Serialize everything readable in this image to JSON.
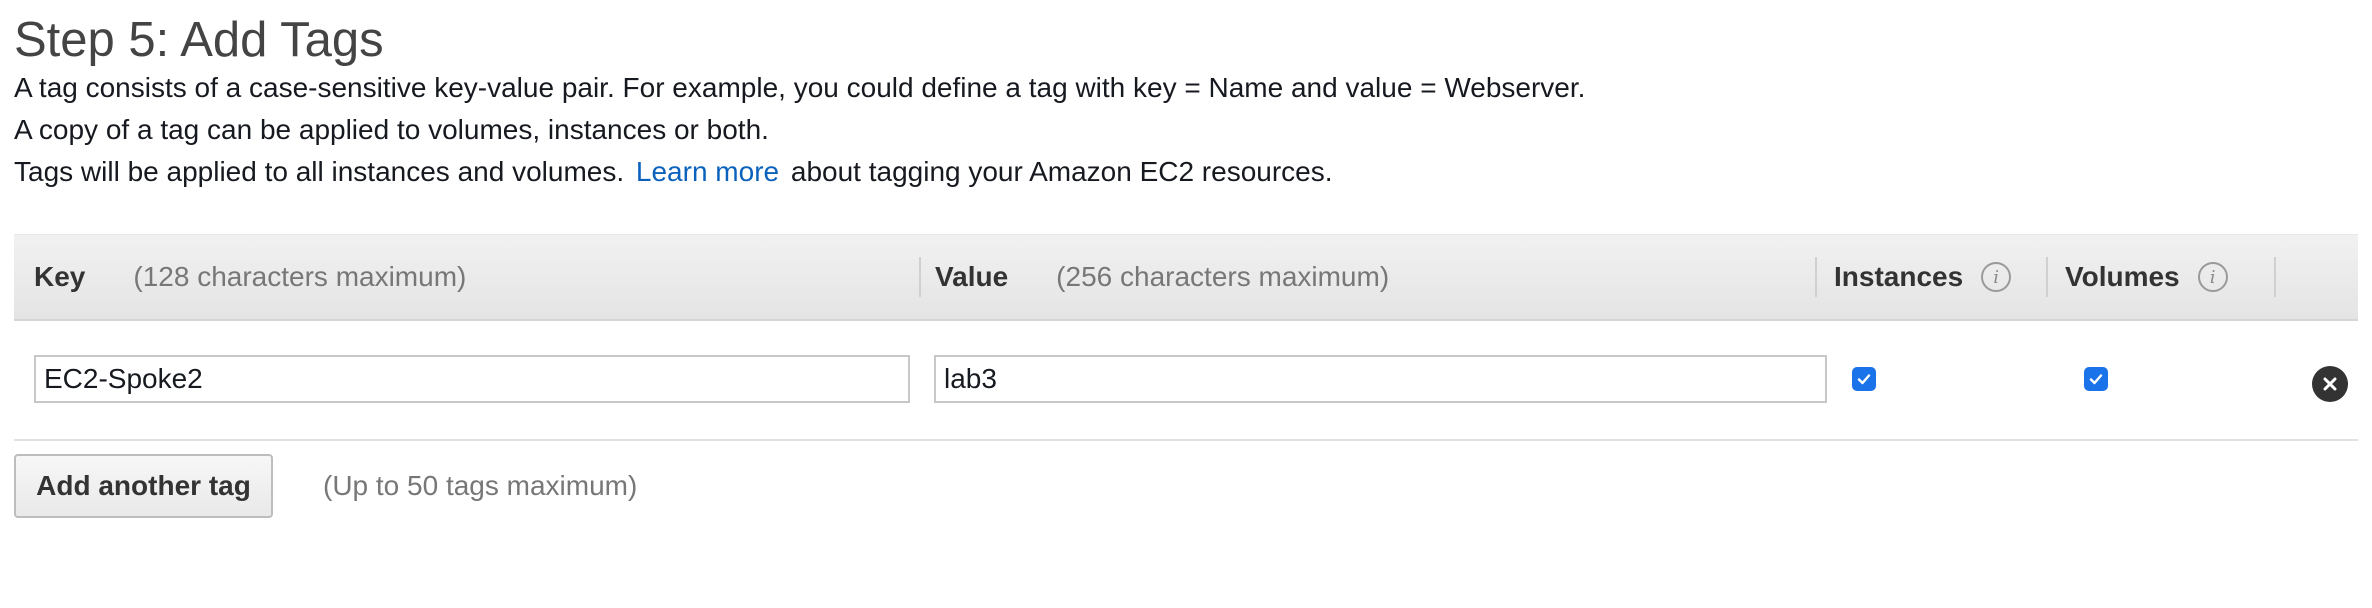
{
  "title": "Step 5: Add Tags",
  "description": {
    "line1": "A tag consists of a case-sensitive key-value pair. For example, you could define a tag with key = Name and value = Webserver.",
    "line2": "A copy of a tag can be applied to volumes, instances or both.",
    "line3_before": "Tags will be applied to all instances and volumes.",
    "line3_link": "Learn more",
    "line3_after": "about tagging your Amazon EC2 resources."
  },
  "table": {
    "headers": {
      "key_label": "Key",
      "key_hint": "(128 characters maximum)",
      "value_label": "Value",
      "value_hint": "(256 characters maximum)",
      "instances_label": "Instances",
      "volumes_label": "Volumes",
      "info_icon_glyph": "i"
    },
    "rows": [
      {
        "key": "EC2-Spoke2",
        "value": "lab3",
        "instances_checked": true,
        "volumes_checked": true
      }
    ]
  },
  "add_tag": {
    "button_label": "Add another tag",
    "hint": "(Up to 50 tags maximum)"
  },
  "colors": {
    "link": "#0a62bd",
    "checkbox": "#1a73e8",
    "remove_icon": "#333333"
  },
  "icons": {
    "info": "info-circle-icon",
    "checkbox": "checkbox-checked-icon",
    "remove": "close-circle-icon"
  }
}
